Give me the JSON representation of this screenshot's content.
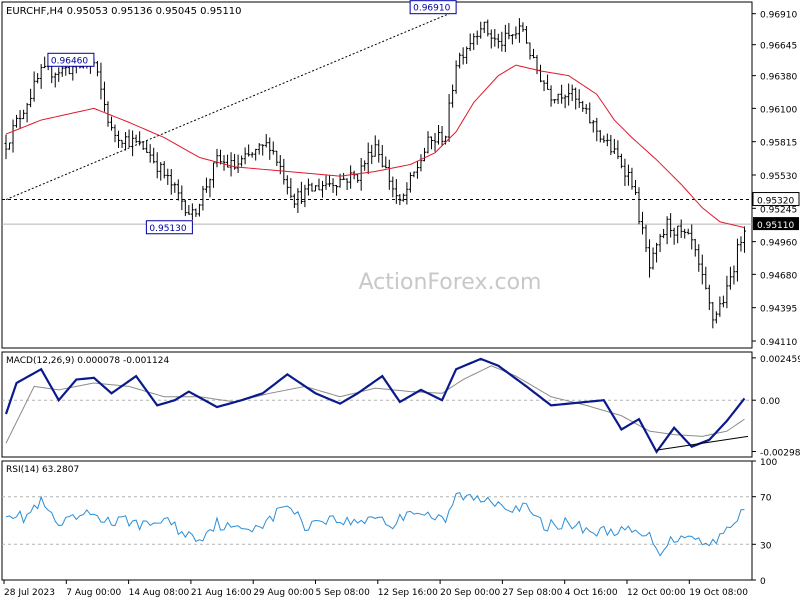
{
  "chart_data": {
    "type": "line",
    "symbol": "EURCHF,H4",
    "ohlc_header": "0.95053 0.95136 0.95045 0.95110",
    "watermark": "ActionForex.com",
    "x_tick_labels": [
      "28 Jul 2023",
      "7 Aug 00:00",
      "14 Aug 08:00",
      "21 Aug 16:00",
      "29 Aug 00:00",
      "5 Sep 08:00",
      "12 Sep 16:00",
      "20 Sep 00:00",
      "27 Sep 08:00",
      "4 Oct 16:00",
      "12 Oct 00:00",
      "19 Oct 08:00"
    ],
    "price_panel": {
      "ylim": [
        0.9405,
        0.9701
      ],
      "y_ticks": [
        0.9691,
        0.96645,
        0.9638,
        0.961,
        0.95815,
        0.9553,
        0.95245,
        0.9496,
        0.9468,
        0.94395,
        0.9411
      ],
      "y_tick_labels": [
        "0.96910",
        "0.96645",
        "0.96380",
        "0.96100",
        "0.95815",
        "0.95530",
        "0.95245",
        "0.94960",
        "0.94680",
        "0.94395",
        "0.94110"
      ],
      "last_price": 0.9511,
      "last_price_label": "0.95110",
      "level_line": 0.9532,
      "level_line_label": "0.95320",
      "annotations": [
        {
          "label": "0.96460",
          "bar": 25,
          "price": 0.9646
        },
        {
          "label": "0.95130",
          "bar": 53,
          "price": 0.9513
        },
        {
          "label": "0.96910",
          "bar": 128,
          "price": 0.9691
        }
      ],
      "trendline": {
        "from": {
          "bar": 0,
          "price": 0.9532
        },
        "to": {
          "bar": 126,
          "price": 0.9691
        }
      },
      "close_series": {
        "name": "Price",
        "knots": [
          [
            0,
            0.958
          ],
          [
            10,
            0.964
          ],
          [
            25,
            0.9648
          ],
          [
            30,
            0.959
          ],
          [
            40,
            0.9575
          ],
          [
            53,
            0.9518
          ],
          [
            60,
            0.9565
          ],
          [
            65,
            0.956
          ],
          [
            75,
            0.958
          ],
          [
            82,
            0.9533
          ],
          [
            90,
            0.9545
          ],
          [
            100,
            0.9553
          ],
          [
            105,
            0.958
          ],
          [
            112,
            0.9527
          ],
          [
            120,
            0.958
          ],
          [
            125,
            0.9588
          ],
          [
            128,
            0.965
          ],
          [
            135,
            0.9682
          ],
          [
            140,
            0.9665
          ],
          [
            147,
            0.9678
          ],
          [
            150,
            0.9648
          ],
          [
            155,
            0.9622
          ],
          [
            160,
            0.9625
          ],
          [
            170,
            0.9583
          ],
          [
            175,
            0.9563
          ],
          [
            178,
            0.9548
          ],
          [
            183,
            0.9473
          ],
          [
            188,
            0.9511
          ],
          [
            195,
            0.9495
          ],
          [
            201,
            0.943
          ],
          [
            205,
            0.9453
          ],
          [
            210,
            0.9511
          ]
        ]
      },
      "ma_series": {
        "name": "MA",
        "knots": [
          [
            0,
            0.9588
          ],
          [
            10,
            0.96
          ],
          [
            25,
            0.961
          ],
          [
            35,
            0.9598
          ],
          [
            45,
            0.9585
          ],
          [
            55,
            0.9568
          ],
          [
            65,
            0.956
          ],
          [
            80,
            0.9556
          ],
          [
            95,
            0.9552
          ],
          [
            105,
            0.9556
          ],
          [
            115,
            0.9562
          ],
          [
            122,
            0.9572
          ],
          [
            128,
            0.959
          ],
          [
            133,
            0.9615
          ],
          [
            140,
            0.9638
          ],
          [
            145,
            0.9647
          ],
          [
            152,
            0.9642
          ],
          [
            160,
            0.9638
          ],
          [
            168,
            0.9622
          ],
          [
            173,
            0.96
          ],
          [
            178,
            0.9585
          ],
          [
            185,
            0.9566
          ],
          [
            192,
            0.9545
          ],
          [
            198,
            0.9525
          ],
          [
            203,
            0.9513
          ],
          [
            210,
            0.9508
          ]
        ]
      }
    },
    "macd_panel": {
      "label": "MACD(12,26,9) 0.000078 -0.001124",
      "ylim": [
        -0.0033,
        0.0028
      ],
      "y_ticks": [
        0.002459,
        0.0,
        -0.00298
      ],
      "y_tick_labels": [
        "0.002459",
        "0.00",
        "-0.00298"
      ],
      "macd_series": {
        "name": "MACD",
        "knots": [
          [
            0,
            -0.0008
          ],
          [
            3,
            0.001
          ],
          [
            10,
            0.0018
          ],
          [
            15,
            0.0
          ],
          [
            20,
            0.0012
          ],
          [
            25,
            0.0013
          ],
          [
            30,
            0.0004
          ],
          [
            37,
            0.0014
          ],
          [
            43,
            -0.0003
          ],
          [
            48,
            0.0
          ],
          [
            52,
            0.0005
          ],
          [
            60,
            -0.0004
          ],
          [
            67,
            0.0
          ],
          [
            73,
            0.0004
          ],
          [
            80,
            0.0015
          ],
          [
            88,
            0.0004
          ],
          [
            95,
            -0.0002
          ],
          [
            100,
            0.0004
          ],
          [
            107,
            0.0014
          ],
          [
            112,
            -0.0001
          ],
          [
            118,
            0.0006
          ],
          [
            124,
            0.0
          ],
          [
            128,
            0.0018
          ],
          [
            135,
            0.0024
          ],
          [
            140,
            0.002
          ],
          [
            148,
            0.0008
          ],
          [
            155,
            -0.0003
          ],
          [
            160,
            -0.0002
          ],
          [
            165,
            -0.0001
          ],
          [
            170,
            0.0
          ],
          [
            175,
            -0.0017
          ],
          [
            180,
            -0.0011
          ],
          [
            185,
            -0.003
          ],
          [
            190,
            -0.0016
          ],
          [
            195,
            -0.0027
          ],
          [
            200,
            -0.0023
          ],
          [
            205,
            -0.0012
          ],
          [
            210,
            0.0001
          ]
        ]
      },
      "signal_series": {
        "name": "Signal",
        "knots": [
          [
            0,
            -0.0025
          ],
          [
            8,
            0.0008
          ],
          [
            15,
            0.0006
          ],
          [
            25,
            0.001
          ],
          [
            35,
            0.0008
          ],
          [
            45,
            0.0002
          ],
          [
            55,
            0.0002
          ],
          [
            65,
            -0.0001
          ],
          [
            75,
            0.0004
          ],
          [
            85,
            0.0008
          ],
          [
            95,
            0.0002
          ],
          [
            105,
            0.0007
          ],
          [
            115,
            0.0005
          ],
          [
            124,
            0.0004
          ],
          [
            130,
            0.0012
          ],
          [
            138,
            0.002
          ],
          [
            145,
            0.0014
          ],
          [
            155,
            0.0002
          ],
          [
            165,
            -0.0003
          ],
          [
            175,
            -0.0009
          ],
          [
            183,
            -0.0018
          ],
          [
            190,
            -0.002
          ],
          [
            198,
            -0.0021
          ],
          [
            205,
            -0.0018
          ],
          [
            210,
            -0.0011
          ]
        ]
      },
      "trendline": {
        "from": {
          "bar": 185,
          "macd": -0.0029
        },
        "to": {
          "bar": 211,
          "macd": -0.0021
        }
      }
    },
    "rsi_panel": {
      "label": "RSI(14) 63.2807",
      "ylim": [
        0,
        100
      ],
      "y_ticks": [
        100,
        70,
        30,
        0
      ],
      "y_tick_labels": [
        "100",
        "70",
        "30",
        "0"
      ],
      "rsi_series": {
        "name": "RSI",
        "knots": [
          [
            0,
            58
          ],
          [
            5,
            52
          ],
          [
            10,
            65
          ],
          [
            15,
            45
          ],
          [
            20,
            52
          ],
          [
            25,
            56
          ],
          [
            30,
            48
          ],
          [
            35,
            50
          ],
          [
            40,
            45
          ],
          [
            45,
            52
          ],
          [
            50,
            40
          ],
          [
            55,
            35
          ],
          [
            60,
            48
          ],
          [
            65,
            42
          ],
          [
            70,
            45
          ],
          [
            75,
            50
          ],
          [
            80,
            65
          ],
          [
            85,
            45
          ],
          [
            90,
            52
          ],
          [
            95,
            50
          ],
          [
            100,
            48
          ],
          [
            105,
            55
          ],
          [
            110,
            45
          ],
          [
            115,
            60
          ],
          [
            120,
            55
          ],
          [
            125,
            48
          ],
          [
            128,
            72
          ],
          [
            133,
            68
          ],
          [
            138,
            68
          ],
          [
            143,
            62
          ],
          [
            148,
            60
          ],
          [
            153,
            45
          ],
          [
            158,
            48
          ],
          [
            163,
            45
          ],
          [
            168,
            40
          ],
          [
            173,
            42
          ],
          [
            178,
            40
          ],
          [
            183,
            36
          ],
          [
            186,
            25
          ],
          [
            190,
            35
          ],
          [
            195,
            40
          ],
          [
            199,
            28
          ],
          [
            203,
            38
          ],
          [
            207,
            45
          ],
          [
            210,
            63
          ]
        ]
      }
    }
  }
}
